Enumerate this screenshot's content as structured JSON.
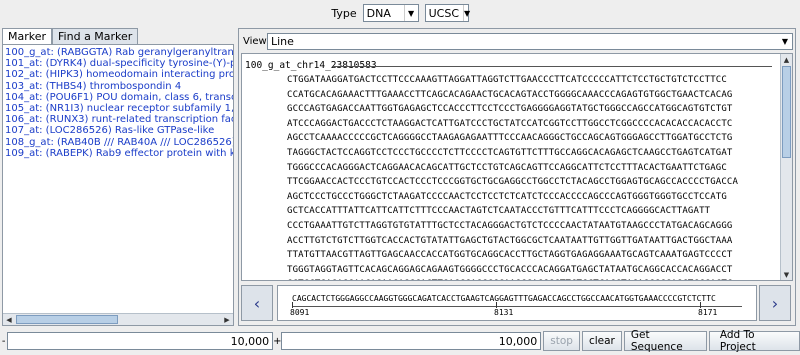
{
  "topbar": {
    "type_label": "Type",
    "type_value": "DNA",
    "source_value": "UCSC"
  },
  "left": {
    "tabs": [
      "Marker",
      "Find a Marker"
    ],
    "markers": [
      "100_g_at: (RABGGTA) Rab geranylgeranyltransferase",
      "101_at: (DYRK4) dual-specificity tyrosine-(Y)-phospho",
      "102_at: (HIPK3) homeodomain interacting protein kina",
      "103_at: (THBS4) thrombospondin 4",
      "104_at: (POU6F1) POU domain, class 6, transcription",
      "105_at: (NR1I3) nuclear receptor subfamily 1, group",
      "106_at: (RUNX3) runt-related transcription factor 3",
      "107_at: (LOC286526) Ras-like GTPase-like",
      "108_g_at: (RAB40B /// RAB40A /// LOC286526) RAB4",
      "109_at: (RABEPK) Rab9 effector protein with kelch mo"
    ]
  },
  "right": {
    "view_label": "View:",
    "view_value": "Line",
    "sequence_title": "100_g_at_chr14_23810583",
    "sequence_lines": [
      "CTGGATAAGGATGACTCCTTCCCAAAGTTAGGATTAGGTCTTGAACCCTTCATCCCCCATTCTCCTGCTGTCTCCTTCC",
      "CCATGCACAGAAACTTTGAAACCTTCAGCACAGAACTGCACAGTACCTGGGGCAAACCCAGAGTGTGGCTGAACTCACAG",
      "GCCCAGTGAGACCAATTGGTGAGAGCTCCACCCTTCCTCCCTGAGGGGAGGTATGCTGGGCCAGCCATGGCAGTGTCTGT",
      "ATCCCAGGACTGACCCTCTAAGGACTCATTGATCCCTGCTATCCATCGGTCCTTGGCCTCGGCCCCACACACCACACCTC",
      "AGCCTCAAAACCCCCGCTCAGGGGCCTAAGAGAGAATTTCCCAACAGGGCTGCCAGCAGTGGGAGCCTTGGATGCCTCTG",
      "TAGGGCTACTCCAGGTCCTCCCTGCCCCTCTTCCCCTCAGTGTTCTTTGCCAGGCACAGAGCTCAAGCCTGAGTCATGAT",
      "TGGGCCCACAGGGACTCAGGAACACAGCATTGCTCCTGTCAGCAGTTCCAGGCATTCTCCTTTACACTGAATTCTGAGC",
      "TTCGGAACCACTCCCTGTCCACTCCCTCCCGGTGCTGCGAGGCCTGGCCTCTACAGCCTGGAGTGCAGCCACCCCTGACCA",
      "AGCTCCCTGCCCTGGGCTCTAAGATCCCCAACTCCTCCTCTCATCTCCCACCCCAGCCCAGTGGGTGGGTGCCTCCATG",
      "GCTCACCATTTATTCATTCATTCTTTCCCAACTAGTCTCAATACCCTGTTTCATTTCCCTCAGGGGCACTTAGATT",
      "CCCTGAAATTGTCTTAGGTGTGTATTTGCTCCTACAGGGACTGTCTCCCCAACTATAATGTAAGCCCTATGACAGCAGGG",
      "ACCTTGTCTGTCTTGGTCACCACTGTATATTGAGCTGTACTGGCGCTCAATAATTGTTGGTTGATAATTGACTGGCTAAA",
      "TTATGTTAACGTTAGTTGAGCAACCACCATGGTGCAGGCACCTTGCTAGGTGAGAGGAAATGCAGTCAAATGAGTCCCCT",
      "TGGGTAGGTAGTTCACAGCAGGAGCAGAAGTGGGGCCCTGCACCCACAGGATGAGCTATAATGCAGGCACCACAGGACCT",
      "GGTGCTGAGAGGAACAGAAGAGGCACTTGACCGAGCCCCAAGCCAGGGCTTCTGCTCACCTACAGCCCCAGCTCCCACTC"
    ],
    "mini_sequence": "CAGCACTCTGGGAGGCCAAGGTGGGCAGATCACCTGAAGTCAGGAGTTTGAGACCAGCCTGGCCAACATGGTGAAACCCCGTCTCTTC",
    "ticks": [
      {
        "label": "8091",
        "pos": 0
      },
      {
        "label": "8131",
        "pos": 40
      },
      {
        "label": "8171",
        "pos": 80
      }
    ]
  },
  "bottom": {
    "field1_value": "10,000",
    "minus": "-",
    "plus": "+",
    "field2_value": "10,000",
    "stop_label": "stop",
    "clear_label": "clear",
    "get_sequence_label": "Get Sequence",
    "add_to_project_label": "Add To Project"
  }
}
